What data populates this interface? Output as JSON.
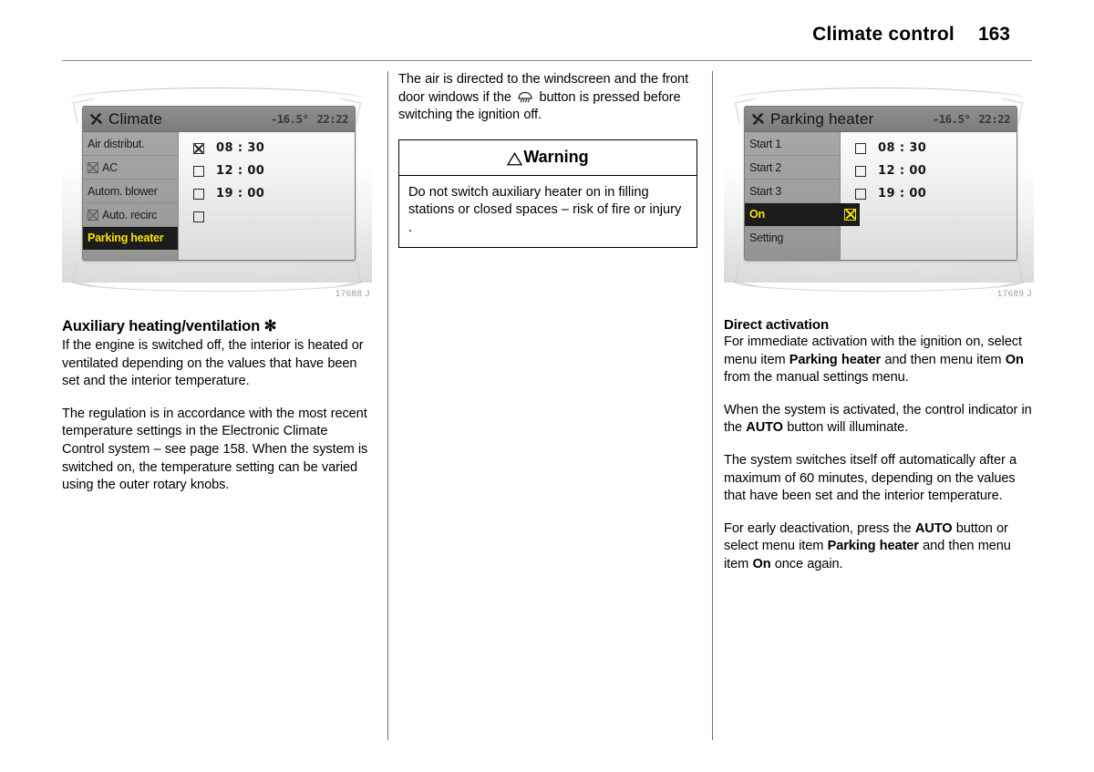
{
  "header": {
    "title": "Climate control",
    "page_number": "163"
  },
  "left_column": {
    "figure": {
      "caption": "17688 J",
      "screen": {
        "icon": "fan-icon",
        "title": "Climate",
        "temperature": "-16.5°",
        "clock": "22:22",
        "menu_items": [
          {
            "label": "Air distribut.",
            "has_checkbox": false,
            "checked": false,
            "selected": false
          },
          {
            "label": "AC",
            "has_checkbox": true,
            "checked": true,
            "selected": false
          },
          {
            "label": "Autom. blower",
            "has_checkbox": false,
            "checked": false,
            "selected": false
          },
          {
            "label": "Auto. recirc",
            "has_checkbox": true,
            "checked": true,
            "selected": false
          },
          {
            "label": "Parking heater",
            "has_checkbox": false,
            "checked": false,
            "selected": true
          }
        ],
        "list_rows": [
          {
            "checked": true,
            "time": "08 : 30"
          },
          {
            "checked": false,
            "time": "12 : 00"
          },
          {
            "checked": false,
            "time": "19 : 00"
          },
          {
            "checked": false,
            "time": ""
          }
        ]
      }
    },
    "heading": "Auxiliary heating/ventilation ✻",
    "paragraphs": [
      "If the engine is switched off, the interior is heated or ventilated depending on the values that have been set and the interior temperature.",
      "The regulation is in accordance with the most recent temperature settings in the Electronic Climate Control system – see page 158. When the system is switched on, the temperature setting can be varied using the outer rotary knobs."
    ]
  },
  "middle_column": {
    "intro_before_icon": "The air is directed to the windscreen and the front door windows if the ",
    "intro_after_icon": " button is pressed before switching the ignition off.",
    "warning": {
      "heading": "Warning",
      "icon": "warning-triangle-icon",
      "body": "Do not switch auxiliary heater on in filling stations or closed spaces – risk of fire or injury ."
    }
  },
  "right_column": {
    "figure": {
      "caption": "17689 J",
      "screen": {
        "icon": "fan-icon",
        "title": "Parking heater",
        "temperature": "-16.5°",
        "clock": "22:22",
        "menu_items": [
          {
            "label": "Start 1",
            "has_checkbox": false,
            "checked": false,
            "selected": false
          },
          {
            "label": "Start 2",
            "has_checkbox": false,
            "checked": false,
            "selected": false
          },
          {
            "label": "Start 3",
            "has_checkbox": false,
            "checked": false,
            "selected": false
          },
          {
            "label": "On",
            "has_checkbox": false,
            "checked": true,
            "selected": true
          },
          {
            "label": "Setting",
            "has_checkbox": false,
            "checked": false,
            "selected": false
          }
        ],
        "list_rows": [
          {
            "checked": false,
            "time": "08 : 30"
          },
          {
            "checked": false,
            "time": "12 : 00"
          },
          {
            "checked": false,
            "time": "19 : 00"
          }
        ]
      }
    },
    "heading": "Direct activation",
    "para1_a": "For immediate activation with the ignition on, select menu item ",
    "para1_b": "Parking heater",
    "para1_c": " and then menu item ",
    "para1_d": "On",
    "para1_e": " from the manual settings menu.",
    "para2_a": "When the system is activated, the control indicator in the ",
    "para2_b": "AUTO",
    "para2_c": " button will illuminate.",
    "para3": "The system switches itself off automatically after a maximum of 60 minutes, depending on the values that have been set and the interior temperature.",
    "para4_a": "For early deactivation, press the ",
    "para4_b": "AUTO",
    "para4_c": " button or select menu item ",
    "para4_d": "Parking heater",
    "para4_e": " and then menu item ",
    "para4_f": "On",
    "para4_g": " once again."
  },
  "colors": {
    "highlight_bg": "#1c1c1c",
    "highlight_text": "#f2e200",
    "screen_header": "#868686",
    "screen_menu": "#9e9e9e",
    "rule": "#8a8a8a"
  }
}
